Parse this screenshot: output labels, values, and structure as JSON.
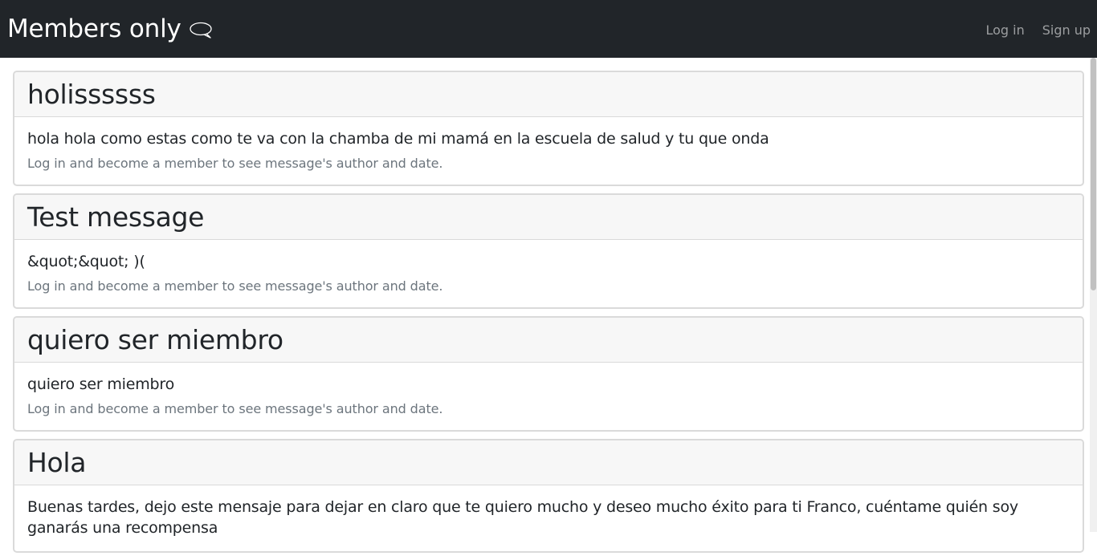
{
  "navbar": {
    "brand": "Members only",
    "brand_icon": "speech-bubble-icon",
    "links": [
      "Log in",
      "Sign up"
    ]
  },
  "messages": [
    {
      "title": "holissssss",
      "body": "hola hola como estas como te va con la chamba de mi mamá en la escuela de salud y tu que onda",
      "meta": "Log in and become a member to see message's author and date."
    },
    {
      "title": "Test message",
      "body": "&quot;&quot; )(",
      "meta": "Log in and become a member to see message's author and date."
    },
    {
      "title": "quiero ser miembro",
      "body": "quiero ser miembro",
      "meta": "Log in and become a member to see message's author and date."
    },
    {
      "title": "Hola",
      "body": "Buenas tardes, dejo este mensaje para dejar en claro que te quiero mucho y deseo mucho éxito para ti Franco, cuéntame quién soy ganarás una recompensa"
    }
  ],
  "colors": {
    "navbar_bg": "#212529",
    "nav_link": "rgba(255,255,255,0.55)",
    "card_header_bg": "#f7f7f7",
    "muted_text": "#6c757d"
  }
}
